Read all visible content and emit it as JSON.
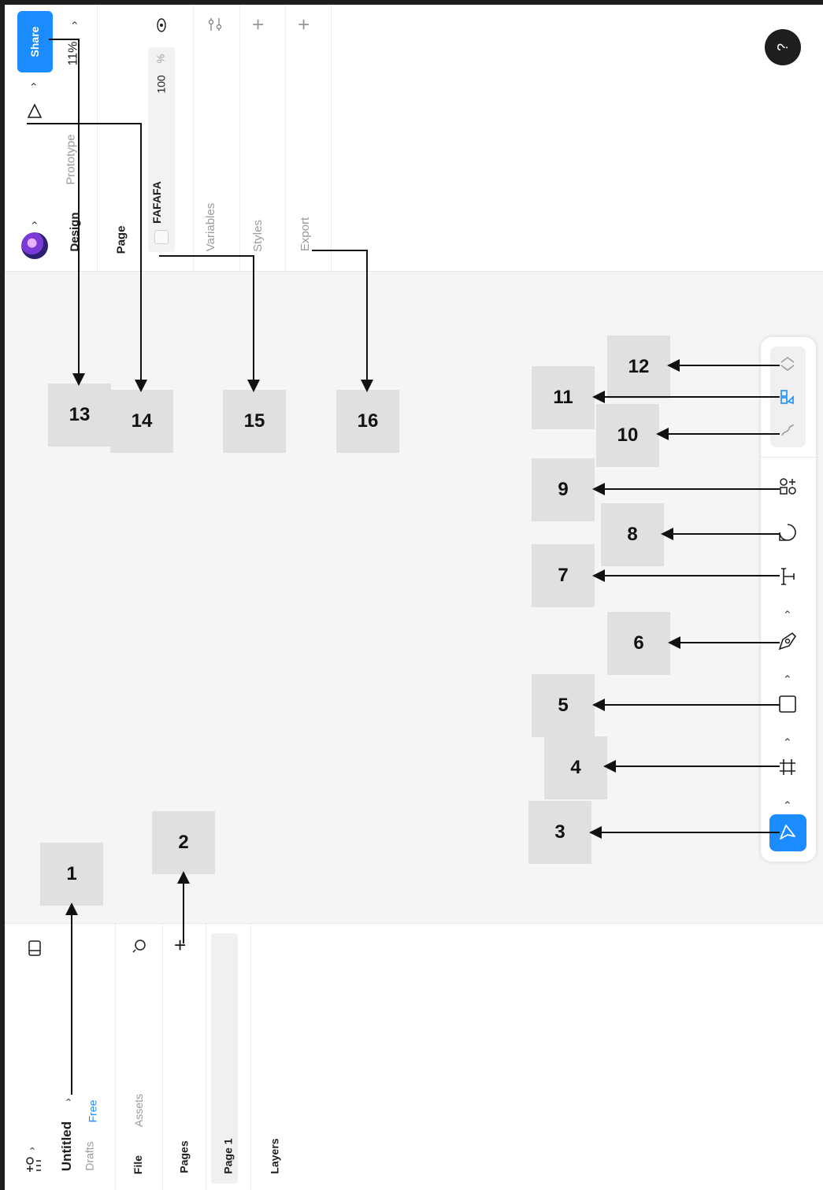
{
  "right_panel": {
    "share_label": "Share",
    "zoom": "11%",
    "tabs": [
      {
        "label": "Design",
        "active": true
      },
      {
        "label": "Prototype",
        "active": false
      }
    ],
    "page_heading": "Page",
    "fill_hex": "FAFAFA",
    "opacity_value": "100",
    "opacity_unit": "%",
    "sections": [
      {
        "label": "Variables"
      },
      {
        "label": "Styles"
      },
      {
        "label": "Export"
      }
    ]
  },
  "left_panel": {
    "file_title": "Untitled",
    "location": "Drafts",
    "plan_badge": "Free",
    "tabs": [
      {
        "label": "File",
        "active": true
      },
      {
        "label": "Assets",
        "active": false
      }
    ],
    "pages_heading": "Pages",
    "pages": [
      {
        "label": "Page 1"
      }
    ],
    "layers_heading": "Layers"
  },
  "help": {
    "label": "?"
  },
  "toolbar": {
    "tools": [
      {
        "icon": "move-icon",
        "active": true
      },
      {
        "icon": "frame-icon"
      },
      {
        "icon": "rectangle-icon"
      },
      {
        "icon": "pen-icon"
      },
      {
        "icon": "text-icon"
      },
      {
        "icon": "comment-icon"
      },
      {
        "icon": "actions-icon"
      },
      {
        "icon": "draw-icon"
      },
      {
        "icon": "design-mode-icon"
      },
      {
        "icon": "dev-mode-icon"
      }
    ]
  },
  "callouts": [
    "1",
    "2",
    "3",
    "4",
    "5",
    "6",
    "7",
    "8",
    "9",
    "10",
    "11",
    "12",
    "13",
    "14",
    "15",
    "16"
  ],
  "colors": {
    "accent": "#1a8cff",
    "canvas": "#f5f5f5",
    "callout_bg": "#e0e0e0",
    "help_bg": "#1e1e1e"
  }
}
